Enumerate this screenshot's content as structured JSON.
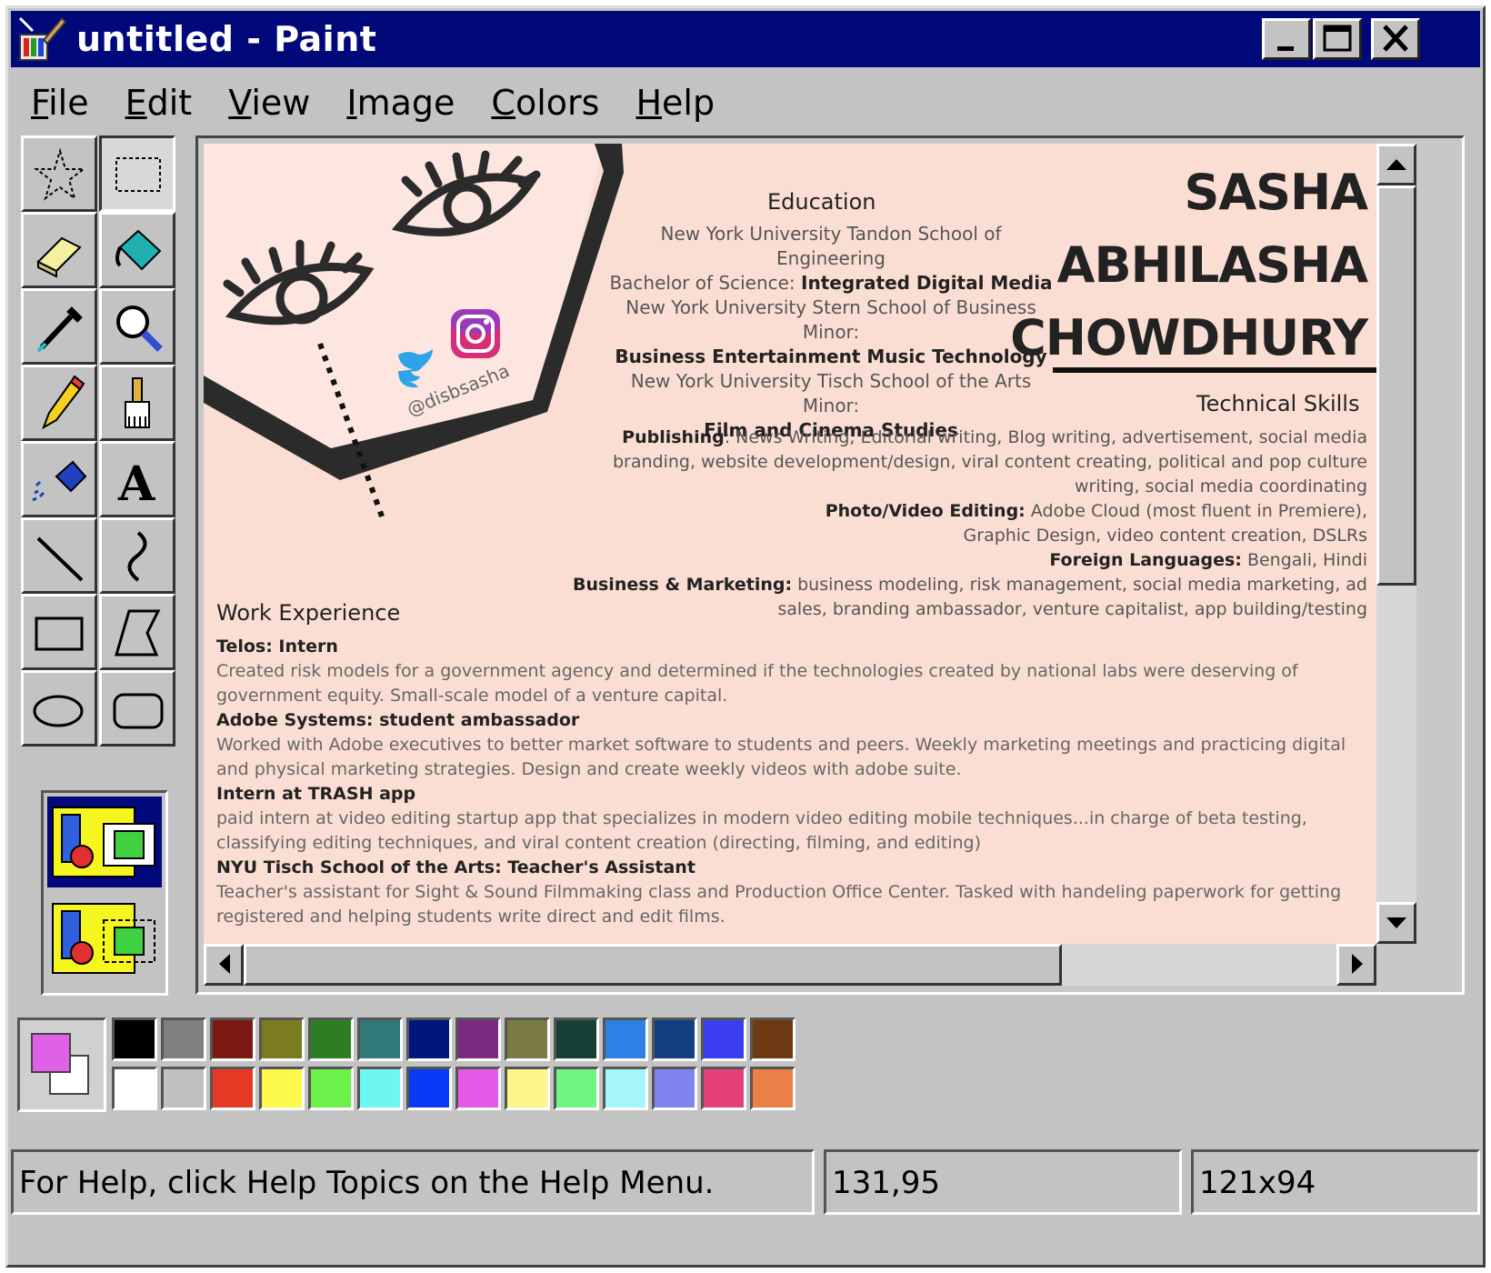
{
  "window": {
    "title": "untitled - Paint"
  },
  "menu": [
    {
      "u": "F",
      "rest": "ile"
    },
    {
      "u": "E",
      "rest": "dit"
    },
    {
      "u": "V",
      "rest": "iew"
    },
    {
      "u": "I",
      "rest": "mage"
    },
    {
      "u": "C",
      "rest": "olors"
    },
    {
      "u": "H",
      "rest": "elp"
    }
  ],
  "resume": {
    "name_line1": "SASHA",
    "name_line2": "ABHILASHA",
    "name_line3": "CHOWDHURY",
    "handle": "@disbsasha",
    "education_heading": "Education",
    "edu_1": "New York University Tandon School of Engineering",
    "edu_2_label": "Bachelor of Science: ",
    "edu_2_value": "Integrated Digital Media",
    "edu_3": "New York University Stern School of Business Minor:",
    "edu_4": "Business Entertainment Music Technology",
    "edu_5": "New York University Tisch School of the Arts Minor:",
    "edu_6": "Film and Cinema Studies",
    "skills_heading": "Technical Skills",
    "skill_pub_label": "Publishing",
    "skill_pub_text": ": News Writing, Editorial writing, Blog writing, advertisement, social media branding, website development/design, viral content creating, political and pop culture writing, social media coordinating",
    "skill_photo_label": "Photo/Video Editing:",
    "skill_photo_text": " Adobe Cloud (most fluent in Premiere), Graphic Design, video content creation, DSLRs",
    "skill_lang_label": "Foreign Languages:",
    "skill_lang_text": " Bengali, Hindi",
    "skill_biz_label": "Business & Marketing:",
    "skill_biz_text": " business modeling, risk management, social media marketing, ad sales, branding ambassador, venture capitalist, app  building/testing",
    "work_heading": "Work Experience",
    "job1_title": "Telos: Intern",
    "job1_desc": "Created risk models for a government agency and determined if the technologies created by national labs were deserving of government equity. Small-scale model of a venture capital.",
    "job2_title": "Adobe Systems: student ambassador",
    "job2_desc": "Worked with Adobe executives to better market software to students and peers. Weekly marketing meetings and practicing digital and physical marketing strategies. Design and create weekly videos with adobe suite.",
    "job3_title": "Intern at TRASH app",
    "job3_desc": "paid intern at video editing startup app that specializes in modern video editing mobile techniques...in charge of beta testing, classifying editing techniques, and viral content creation (directing, filming, and editing)",
    "job4_title": "NYU Tisch School of the Arts: Teacher's Assistant",
    "job4_desc": "Teacher's assistant for Sight & Sound Filmmaking class and Production Office Center. Tasked with handeling paperwork for getting registered and helping students write direct and edit films."
  },
  "palette": {
    "foreground": "#e060e8",
    "background": "#ffffff",
    "row1": [
      "#000000",
      "#808080",
      "#7a1a12",
      "#7b7b22",
      "#2d7d22",
      "#2f7a78",
      "#00157e",
      "#7a2a7e",
      "#797a44",
      "#173f36",
      "#2f80e6",
      "#133e80",
      "#3a3ef0",
      "#6e3a13"
    ],
    "row2": [
      "#ffffff",
      "#c0c0c0",
      "#e43a24",
      "#fdf94c",
      "#6cf04a",
      "#6ef6f2",
      "#0b3af6",
      "#e55be8",
      "#fbf687",
      "#6ef584",
      "#a5f7f7",
      "#7f84f0",
      "#e3407a",
      "#ea8048"
    ]
  },
  "status": {
    "help": "For Help, click Help Topics on the Help Menu.",
    "coords": "131,95",
    "size": "121x94"
  }
}
